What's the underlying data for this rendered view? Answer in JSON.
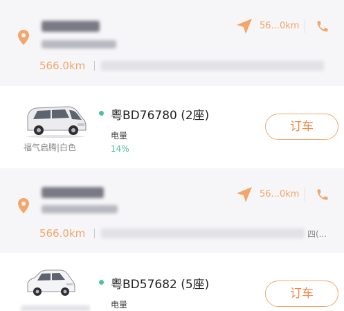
{
  "stores": [
    {
      "nav_distance": "56...0km",
      "distance": "566.0km",
      "cars": [
        {
          "model": "福气启腾|白色",
          "plate": "粤BD76780 (2座)",
          "battery_label": "电量",
          "battery_value": "14%",
          "book_label": "订车",
          "image_icon": "van-icon"
        }
      ]
    },
    {
      "nav_distance": "56...0km",
      "distance": "566.0km",
      "address_tail": "四(...",
      "cars": [
        {
          "model": "",
          "plate": "粤BD57682 (5座)",
          "battery_label": "电量",
          "battery_value": "",
          "book_label": "订车",
          "image_icon": "hatchback-icon"
        }
      ]
    }
  ],
  "colors": {
    "accent": "#f3a56a",
    "button_text": "#f08a4b",
    "battery": "#4cc39a",
    "header_bg": "#f6f6f8"
  },
  "icons": {
    "location": "map-pin-icon",
    "navigate": "navigation-arrow-icon",
    "phone": "phone-icon"
  }
}
